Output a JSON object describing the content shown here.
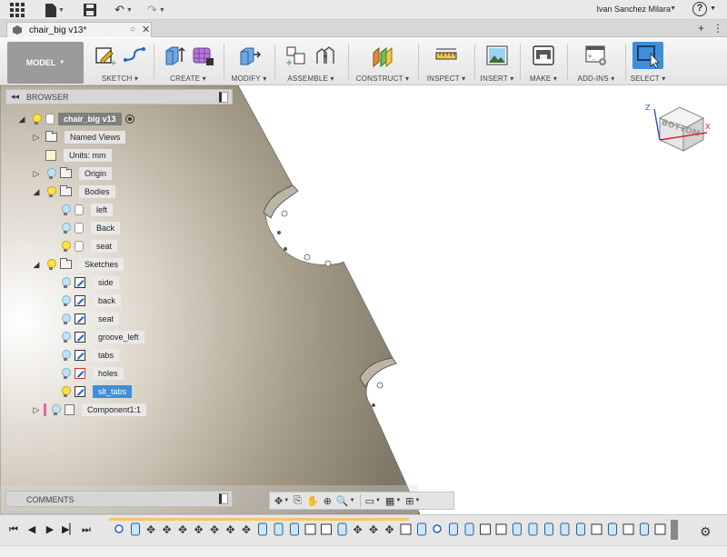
{
  "user": {
    "name": "Ivan Sanchez Milara"
  },
  "document": {
    "title": "chair_big v13*"
  },
  "toolbar": {
    "workspace": "MODEL",
    "groups": [
      {
        "label": "SKETCH"
      },
      {
        "label": "CREATE"
      },
      {
        "label": "MODIFY"
      },
      {
        "label": "ASSEMBLE"
      },
      {
        "label": "CONSTRUCT"
      },
      {
        "label": "INSPECT"
      },
      {
        "label": "INSERT"
      },
      {
        "label": "MAKE"
      },
      {
        "label": "ADD-INS"
      },
      {
        "label": "SELECT"
      }
    ]
  },
  "browser": {
    "title": "BROWSER",
    "root": "chair_big v13",
    "named_views": "Named Views",
    "units": "Units: mm",
    "origin": "Origin",
    "bodies": "Bodies",
    "body_items": [
      "left",
      "Back",
      "seat"
    ],
    "sketches": "Sketches",
    "sketch_items": [
      "side",
      "back",
      "seat",
      "groove_left",
      "tabs",
      "holes",
      "slt_tabs"
    ],
    "component": "Component1:1"
  },
  "viewcube": {
    "face_label": "BOTTOM",
    "axes": {
      "x": "X",
      "z": "Z"
    },
    "colors": {
      "x": "#e0162b",
      "z": "#2c52c9"
    }
  },
  "comments": {
    "title": "COMMENTS"
  },
  "colors": {
    "accent": "#3e8fd8",
    "timeline": "#f3c56b",
    "body_fill": "#9a9181"
  }
}
